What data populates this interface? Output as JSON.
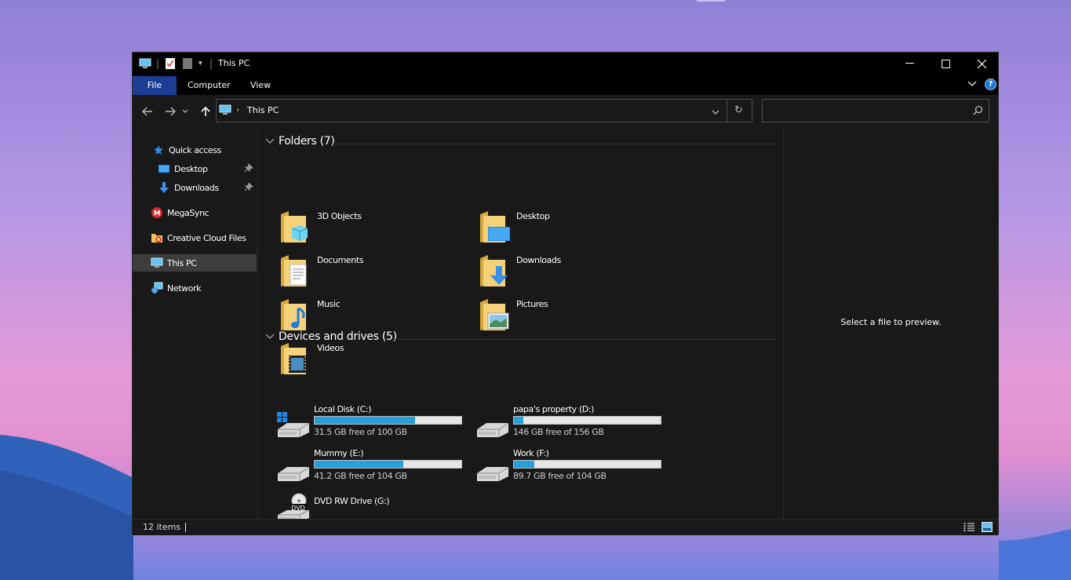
{
  "window": {
    "title": "This PC"
  },
  "ribbon": {
    "tabs": [
      "File",
      "Computer",
      "View"
    ]
  },
  "address": {
    "location": "This PC"
  },
  "search": {
    "placeholder": ""
  },
  "sidebar": {
    "items": [
      {
        "label": "Quick access",
        "icon": "star-icon"
      },
      {
        "label": "Desktop",
        "icon": "desktop-icon",
        "pinned": true
      },
      {
        "label": "Downloads",
        "icon": "download-arrow-icon",
        "pinned": true
      },
      {
        "label": "MegaSync",
        "icon": "mega-icon"
      },
      {
        "label": "Creative Cloud Files",
        "icon": "creative-cloud-icon"
      },
      {
        "label": "This PC",
        "icon": "computer-icon",
        "selected": true
      },
      {
        "label": "Network",
        "icon": "network-icon"
      }
    ]
  },
  "folders": {
    "header": "Folders (7)",
    "items": [
      {
        "label": "3D Objects",
        "icon": "3d-objects-folder-icon"
      },
      {
        "label": "Desktop",
        "icon": "desktop-folder-icon"
      },
      {
        "label": "Documents",
        "icon": "documents-folder-icon"
      },
      {
        "label": "Downloads",
        "icon": "downloads-folder-icon"
      },
      {
        "label": "Music",
        "icon": "music-folder-icon"
      },
      {
        "label": "Pictures",
        "icon": "pictures-folder-icon"
      },
      {
        "label": "Videos",
        "icon": "videos-folder-icon"
      }
    ]
  },
  "drives": {
    "header": "Devices and drives (5)",
    "items": [
      {
        "label": "Local Disk (C:)",
        "free": "31.5 GB free of 100 GB",
        "used_fraction": 0.685,
        "icon": "windows-drive-icon"
      },
      {
        "label": "papa's property  (D:)",
        "free": "146 GB free of 156 GB",
        "used_fraction": 0.064,
        "icon": "hard-drive-icon"
      },
      {
        "label": "Mummy  (E:)",
        "free": "41.2 GB free of 104 GB",
        "used_fraction": 0.604,
        "icon": "hard-drive-icon"
      },
      {
        "label": "Work (F:)",
        "free": "89.7 GB free of 104 GB",
        "used_fraction": 0.138,
        "icon": "hard-drive-icon"
      },
      {
        "label": "DVD RW Drive (G:)",
        "icon": "dvd-drive-icon"
      }
    ]
  },
  "preview": {
    "text": "Select a file to preview."
  },
  "status": {
    "count": "12 items"
  },
  "colors": {
    "accent": "#1b3d94",
    "bar_fill": "#26a0da",
    "background": "#191919"
  }
}
